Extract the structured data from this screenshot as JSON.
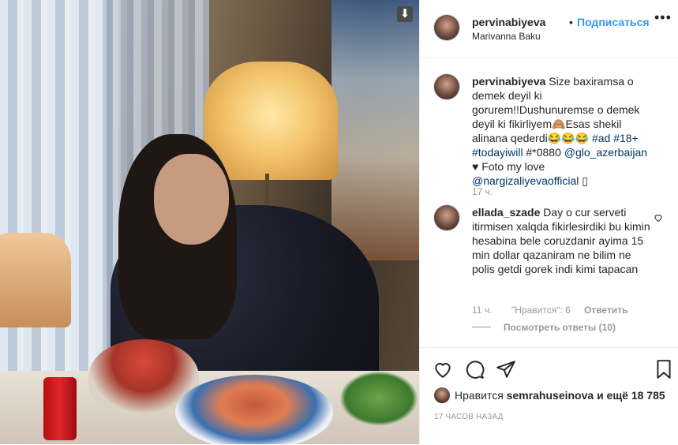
{
  "header": {
    "username": "pervinabiyeva",
    "dot": "•",
    "follow_label": "Подписаться",
    "location": "Marivanna Baku",
    "more": "•••"
  },
  "caption": {
    "username": "pervinabiyeva",
    "text_1": "Size baxiramsa o demek deyil ki gorurem!!Dushunuremse o demek deyil ki fikirliyem🙈Esas shekil alinana qederdi😂😂😂",
    "hashtag_1": "#ad",
    "hashtag_2": "#18+",
    "hashtag_3": "#todayiwill",
    "text_2": "#*0880",
    "mention_1": "@glo_azerbaijan",
    "text_3": "♥ Foto my love",
    "mention_2": "@nargizaliyevaofficial",
    "text_4": "▯",
    "time": "17 ч."
  },
  "comment": {
    "username": "ellada_szade",
    "text": "Day o cur serveti itirmisen xalqda fikirlesirdiki bu kimin hesabina bele coruzdanir ayima 15 min dollar qazaniram ne bilim ne polis getdi gorek indi kimi tapacan",
    "time": "11 ч.",
    "likes": "\"Нравится\": 6",
    "reply": "Ответить",
    "view_replies": "Посмотреть ответы (10)"
  },
  "footer": {
    "likes_prefix": "Нравится",
    "liker": "semrahuseinova",
    "likes_suffix": "и ещё 18 785",
    "post_time": "17 ЧАСОВ НАЗАД"
  },
  "icons": {
    "download": "download-icon",
    "heart": "heart-icon",
    "comment": "comment-icon",
    "share": "share-icon",
    "bookmark": "bookmark-icon"
  },
  "colors": {
    "link": "#3897f0",
    "tag": "#003569",
    "muted": "#999999"
  }
}
